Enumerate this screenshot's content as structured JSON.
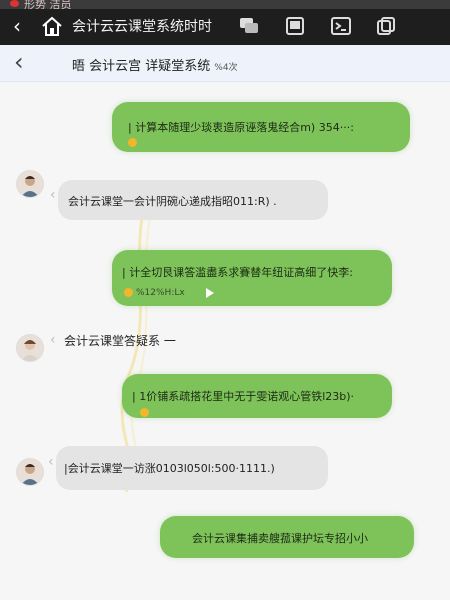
{
  "status_strip": {
    "text": "形势 洁员"
  },
  "browser": {
    "title": "会计云云课堂系统时时",
    "icons": [
      "back-icon",
      "home-icon",
      "chat-icon",
      "window-icon",
      "terminal-icon",
      "copy-icon"
    ]
  },
  "header": {
    "title": "晤 会计云宫 详疑堂系统",
    "subtitle": "%4次"
  },
  "messages": [
    {
      "side": "right",
      "text": "| 计算本随理少琰衷造原诬落鬼经合m) 354···:"
    },
    {
      "side": "left",
      "text": "会计云课堂一会计阴碗心递成指昭011:R) ."
    },
    {
      "side": "right",
      "text": "| 计全切艮课答滥盡系求賽替年纽证高细了快李:",
      "meta": "%12%H:Lx"
    },
    {
      "side": "left",
      "text": "会计云课堂答疑系 一"
    },
    {
      "side": "right",
      "text": "| 1价铺系疏搭花里中无于雯诺观心管铁l23b)·"
    },
    {
      "side": "left",
      "text": "|会计云课堂一访涨0103l050l:500·1111.)"
    },
    {
      "side": "right",
      "text": "会计云课集捕卖艘菰课护坛专招小小"
    }
  ],
  "colors": {
    "green_bubble": "#7dc35a",
    "grey_bubble": "#e4e4e4",
    "header_bg": "#eef3fb",
    "browser_bg": "#1e1e1e"
  }
}
